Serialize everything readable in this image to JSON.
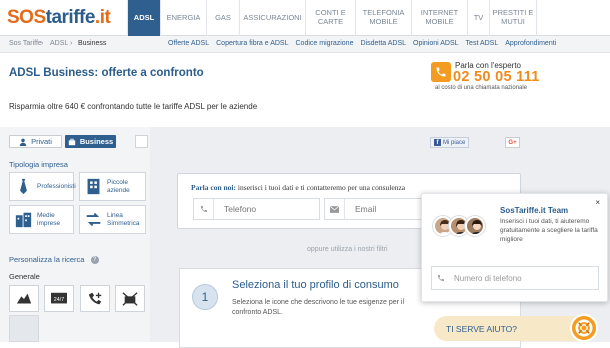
{
  "brand": {
    "logo_part1": "SOS",
    "logo_part2": "tariffe",
    "logo_part3": ".it"
  },
  "topnav": {
    "items": [
      {
        "label": "ADSL",
        "active": true
      },
      {
        "label": "ENERGIA"
      },
      {
        "label": "GAS"
      },
      {
        "label": "ASSICURAZIONI"
      },
      {
        "label": "CONTI E CARTE"
      },
      {
        "label": "TELEFONIA MOBILE"
      },
      {
        "label": "INTERNET MOBILE"
      },
      {
        "label": "TV"
      },
      {
        "label": "PRESTITI E MUTUI"
      }
    ]
  },
  "breadcrumb": {
    "home": "Sos Tariffe",
    "sep": "›",
    "level1": "ADSL",
    "current": "Business"
  },
  "sublinks": [
    "Offerte ADSL",
    "Copertura fibra e ADSL",
    "Codice migrazione",
    "Disdetta ADSL",
    "Opinioni ADSL",
    "Test ADSL",
    "Approfondimenti"
  ],
  "page": {
    "title": "ADSL Business: offerte a confronto",
    "subtitle": "Risparmia oltre 640 € confrontando tutte le tariffe ADSL per le aziende"
  },
  "expert": {
    "label": "Parla con l'esperto",
    "number": "02 50 05 111",
    "cost": "al costo di una chiamata nazionale"
  },
  "toggle": {
    "private": "Privati",
    "business": "Business"
  },
  "social": {
    "fb": "Mi piace",
    "gplus": "G+"
  },
  "filters": {
    "tipologia_title": "Tipologia impresa",
    "tipologia": [
      "Professionisti",
      "Piccole aziende",
      "Medie imprese",
      "Linea Simmetrica"
    ],
    "personalizza_title": "Personalizza la ricerca",
    "generale_title": "Generale"
  },
  "contact": {
    "lead_bold": "Parla con noi:",
    "lead_text": " inserisci i tuoi dati e ti contatteremo per una consulenza",
    "phone_placeholder": "Telefono",
    "email_placeholder": "Email"
  },
  "oppure": "oppure utilizza i nostri filtri",
  "step": {
    "number": "1",
    "title": "Seleziona il tuo profilo di consumo",
    "desc": "Seleziona le icone che descrivono le tue esigenze per il confronto ADSL."
  },
  "chat": {
    "close": "×",
    "team": "SosTariffe.it Team",
    "desc": "Inserisci i tuoi dati, ti aiuteremo gratuitamente a scegliere la tariffa migliore",
    "placeholder": "Numero di telefono",
    "cta": "TI SERVE AIUTO?"
  },
  "colors": {
    "brand_blue": "#2f5f8f",
    "orange": "#f39c21",
    "panel": "#eceef1"
  }
}
